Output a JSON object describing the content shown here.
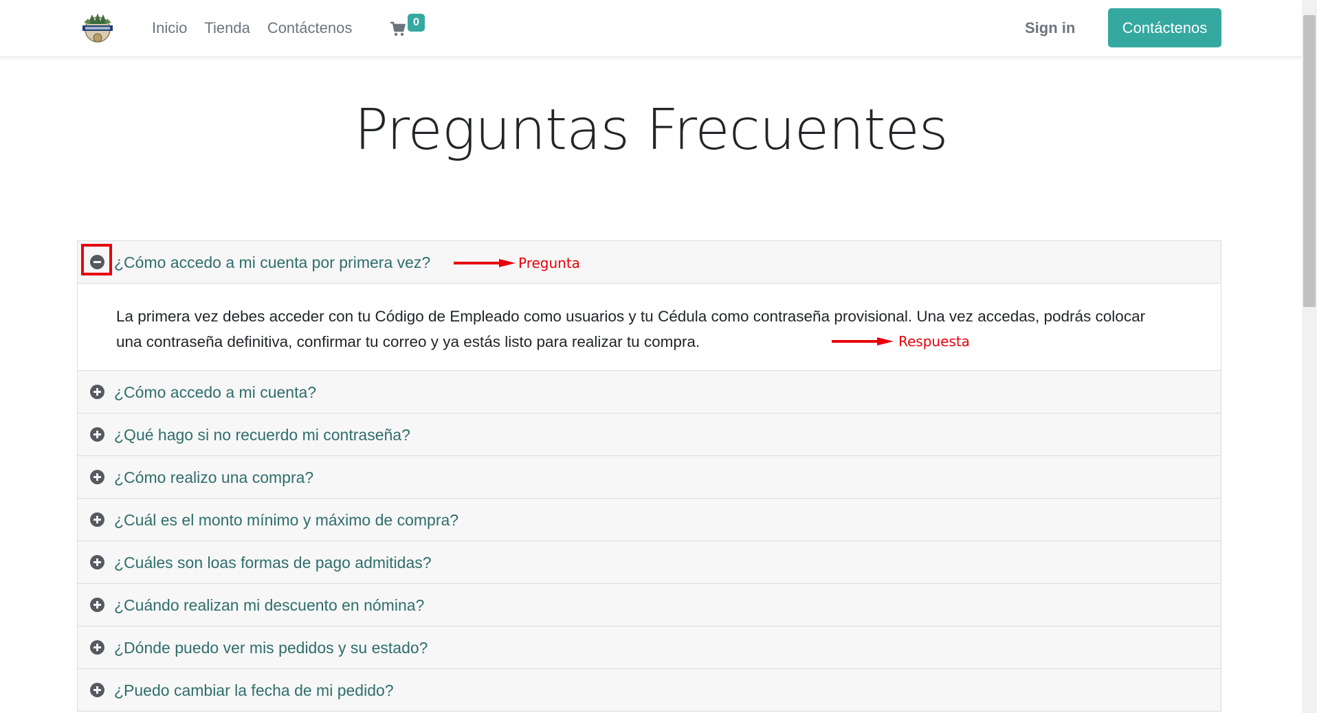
{
  "nav": {
    "links": [
      "Inicio",
      "Tienda",
      "Contáctenos"
    ],
    "cart_count": "0",
    "sign_in": "Sign in",
    "contact_button": "Contáctenos"
  },
  "page": {
    "title": "Preguntas Frecuentes"
  },
  "faq": {
    "items": [
      {
        "question": "¿Cómo accedo a mi cuenta por primera vez?",
        "expanded": true,
        "answer": "La primera vez debes acceder con tu Código de Empleado como usuarios y tu Cédula como contraseña provisional. Una vez accedas, podrás colocar una contraseña definitiva, confirmar tu correo y ya estás listo para realizar tu compra."
      },
      {
        "question": "¿Cómo accedo a mi cuenta?",
        "expanded": false
      },
      {
        "question": "¿Qué hago si no recuerdo mi contraseña?",
        "expanded": false
      },
      {
        "question": "¿Cómo realizo una compra?",
        "expanded": false
      },
      {
        "question": "¿Cuál es el monto mínimo y máximo de compra?",
        "expanded": false
      },
      {
        "question": "¿Cuáles son loas formas de pago admitidas?",
        "expanded": false
      },
      {
        "question": "¿Cuándo realizan mi descuento en nómina?",
        "expanded": false
      },
      {
        "question": "¿Dónde puedo ver mis pedidos y su estado?",
        "expanded": false
      },
      {
        "question": "¿Puedo cambiar la fecha de mi pedido?",
        "expanded": false
      }
    ]
  },
  "annotations": {
    "question_label": "Pregunta",
    "answer_label": "Respuesta"
  },
  "colors": {
    "accent": "#35a8a0",
    "question_text": "#2e6e6b",
    "annotation": "#e8000b"
  },
  "icons": {
    "cart": "shopping-cart-icon",
    "expanded": "minus-circle-icon",
    "collapsed": "plus-circle-icon"
  }
}
